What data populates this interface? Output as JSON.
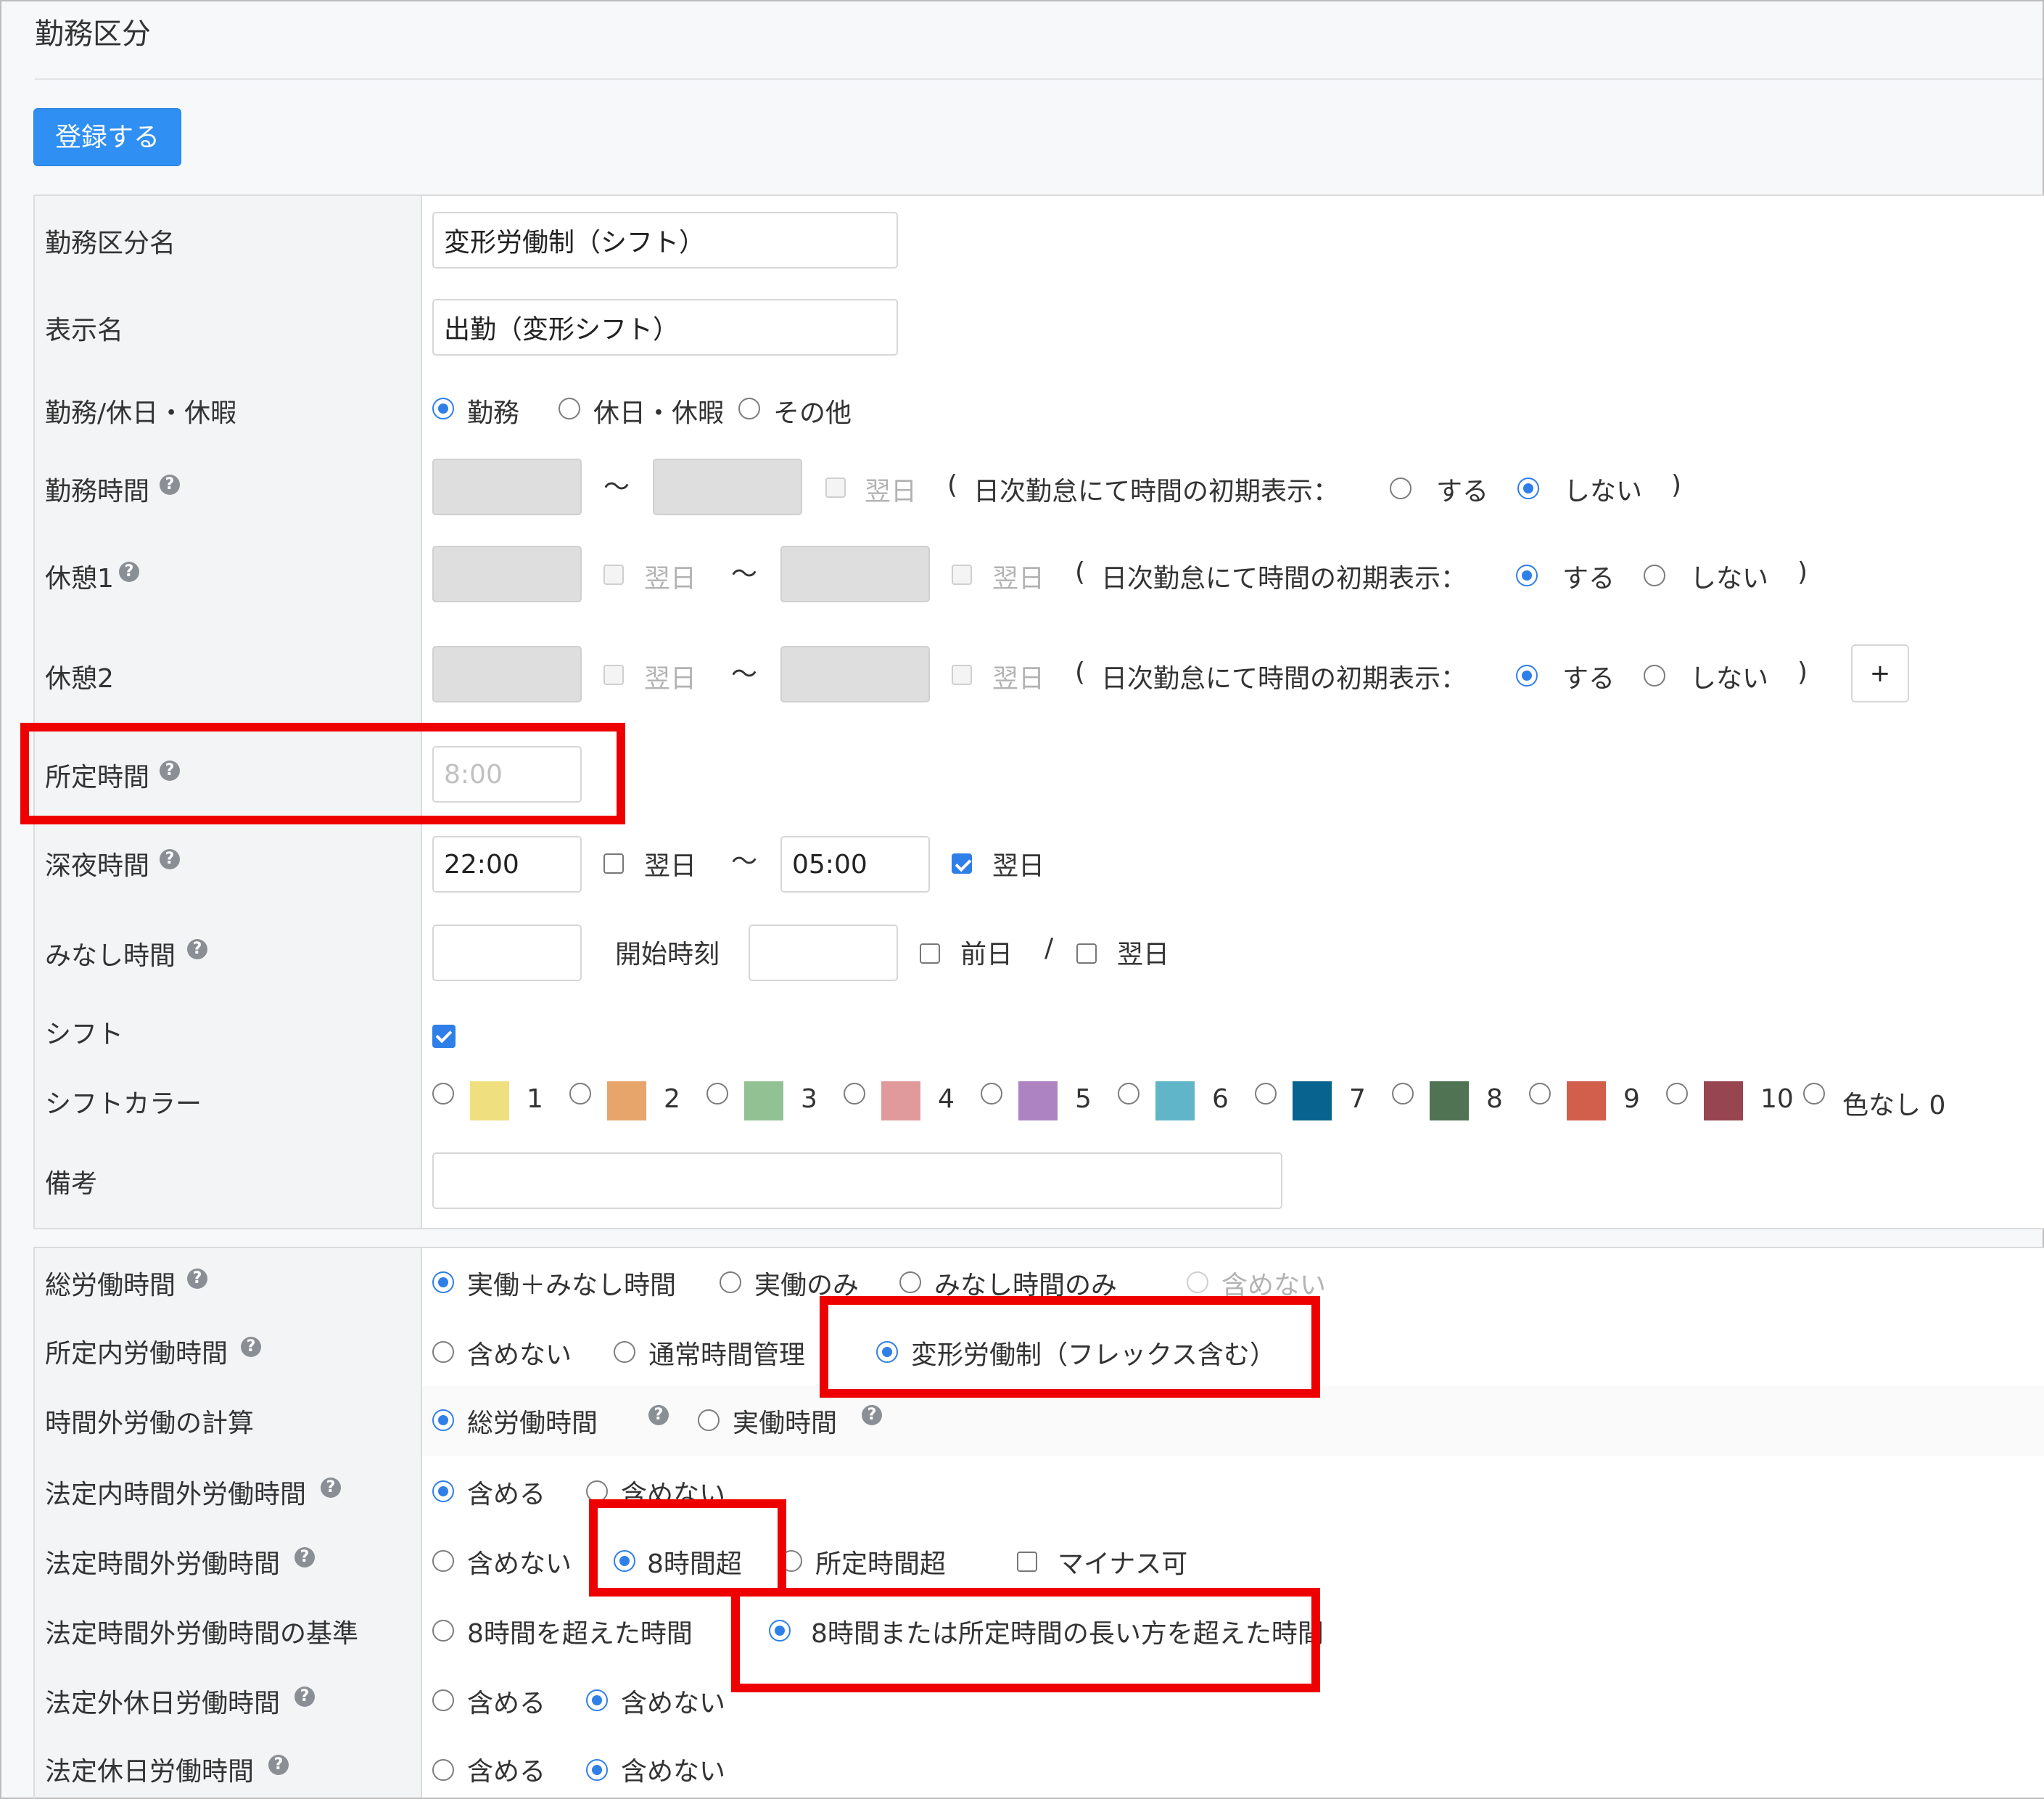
{
  "page": {
    "title": "勤務区分",
    "register_label": "登録する"
  },
  "common": {
    "tilde": "〜",
    "next_day": "翌日",
    "prev_day": "前日",
    "slash": "/",
    "paren_open": "(",
    "paren_close": ")",
    "initial_display_label": "日次勤怠にて時間の初期表示：",
    "do": "する",
    "dont": "しない",
    "plus": "+"
  },
  "form": {
    "name": {
      "label": "勤務区分名",
      "value": "変形労働制（シフト）"
    },
    "display_name": {
      "label": "表示名",
      "value": "出勤（変形シフト）"
    },
    "work_type": {
      "label": "勤務/休日・休暇",
      "options": [
        "勤務",
        "休日・休暇",
        "その他"
      ],
      "selected": "勤務"
    },
    "work_time": {
      "label": "勤務時間"
    },
    "break1": {
      "label": "休憩1"
    },
    "break2": {
      "label": "休憩2"
    },
    "scheduled_time": {
      "label": "所定時間",
      "placeholder": "8:00"
    },
    "night_time": {
      "label": "深夜時間",
      "start": "22:00",
      "end": "05:00"
    },
    "deemed_time": {
      "label": "みなし時間",
      "start_label": "開始時刻"
    },
    "shift": {
      "label": "シフト"
    },
    "shift_color": {
      "label": "シフトカラー",
      "colors": [
        {
          "num": "1",
          "hex": "#efdf7e"
        },
        {
          "num": "2",
          "hex": "#e7a56c"
        },
        {
          "num": "3",
          "hex": "#92c293"
        },
        {
          "num": "4",
          "hex": "#e09a9c"
        },
        {
          "num": "5",
          "hex": "#ad84c1"
        },
        {
          "num": "6",
          "hex": "#61b5c9"
        },
        {
          "num": "7",
          "hex": "#08638e"
        },
        {
          "num": "8",
          "hex": "#4f7353"
        },
        {
          "num": "9",
          "hex": "#d15f4c"
        },
        {
          "num": "10",
          "hex": "#974550"
        }
      ],
      "none_label": "色なし 0"
    },
    "remarks": {
      "label": "備考"
    }
  },
  "calc": {
    "total": {
      "label": "総労働時間",
      "options": [
        "実働＋みなし時間",
        "実働のみ",
        "みなし時間のみ",
        "含めない"
      ],
      "selected": "実働＋みなし時間"
    },
    "scheduled_in": {
      "label": "所定内労働時間",
      "options": [
        "含めない",
        "通常時間管理",
        "変形労働制（フレックス含む）"
      ],
      "selected": "変形労働制（フレックス含む）"
    },
    "overtime_calc": {
      "label": "時間外労働の計算",
      "options": [
        "総労働時間",
        "実働時間"
      ],
      "selected": "総労働時間"
    },
    "legal_in_overtime": {
      "label": "法定内時間外労働時間",
      "options": [
        "含める",
        "含めない"
      ],
      "selected": "含める"
    },
    "legal_overtime": {
      "label": "法定時間外労働時間",
      "options": [
        "含めない",
        "8時間超",
        "所定時間超"
      ],
      "selected": "8時間超",
      "minus_label": "マイナス可"
    },
    "legal_overtime_basis": {
      "label": "法定時間外労働時間の基準",
      "options": [
        "8時間を超えた時間",
        "8時間または所定時間の長い方を超えた時間"
      ],
      "selected": "8時間または所定時間の長い方を超えた時間"
    },
    "non_legal_holiday": {
      "label": "法定外休日労働時間",
      "options": [
        "含める",
        "含めない"
      ],
      "selected": "含めない"
    },
    "legal_holiday": {
      "label": "法定休日労働時間",
      "options": [
        "含める",
        "含めない"
      ],
      "selected": "含めない"
    }
  },
  "colors": {
    "accent": "#2f7fe8",
    "highlight": "#ee0000"
  }
}
